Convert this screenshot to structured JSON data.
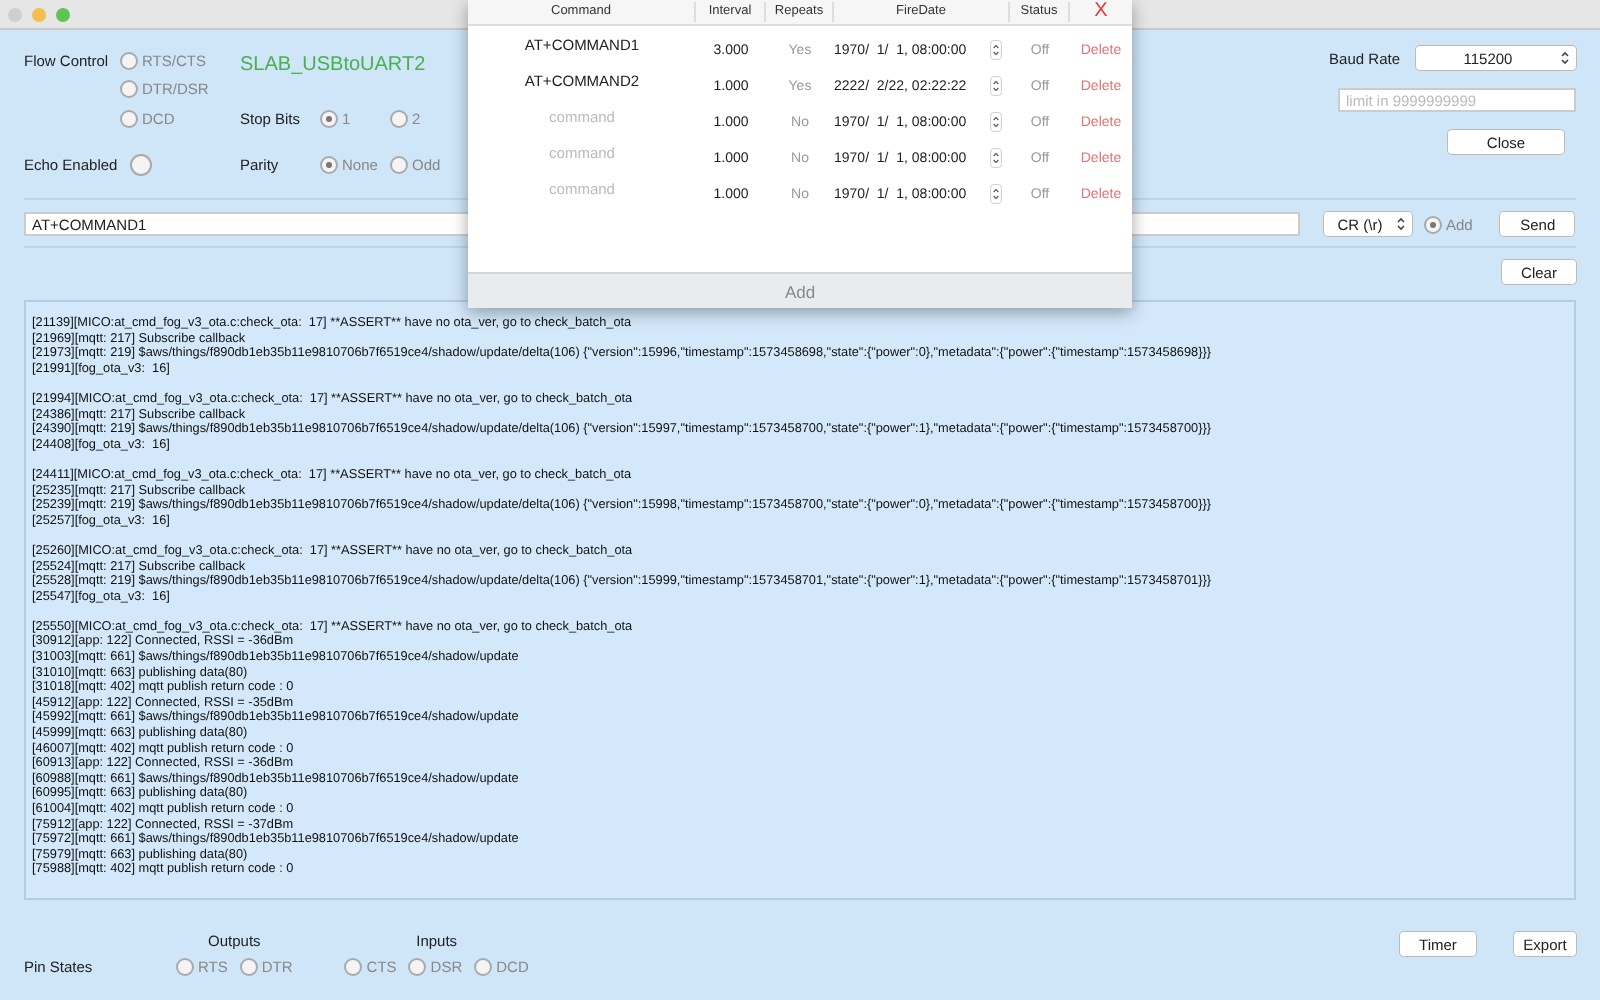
{
  "flow_control": {
    "label": "Flow Control",
    "options": [
      {
        "label": "RTS/CTS",
        "selected": false
      },
      {
        "label": "DTR/DSR",
        "selected": false
      },
      {
        "label": "DCD",
        "selected": false
      }
    ]
  },
  "device": "SLAB_USBtoUART2",
  "stop_bits": {
    "label": "Stop Bits",
    "options": [
      {
        "label": "1",
        "selected": true
      },
      {
        "label": "2",
        "selected": false
      }
    ]
  },
  "echo": {
    "label": "Echo Enabled",
    "checked": false
  },
  "parity": {
    "label": "Parity",
    "options": [
      {
        "label": "None",
        "selected": true
      },
      {
        "label": "Odd",
        "selected": false
      }
    ]
  },
  "baud_rate": {
    "label": "Baud Rate",
    "value": "115200"
  },
  "limit_field": {
    "placeholder": "limit in 9999999999"
  },
  "close_button": "Close",
  "command_field": {
    "value": "AT+COMMAND1"
  },
  "line_ending": {
    "value": "CR (\\r)"
  },
  "add_option": {
    "label": "Add",
    "selected": true
  },
  "send_button": "Send",
  "clear_button": "Clear",
  "log": [
    [
      "[21139][MICO:at_cmd_fog_v3_ota.c:check_ota:  17] **ASSERT** have no ota_ver, go to check_batch_ota",
      "[21969][mqtt: 217] Subscribe callback",
      "[21973][mqtt: 219] $aws/things/f890db1eb35b11e9810706b7f6519ce4/shadow/update/delta(106) {\"version\":15996,\"timestamp\":1573458698,\"state\":{\"power\":0},\"metadata\":{\"power\":{\"timestamp\":1573458698}}}",
      "[21991][fog_ota_v3:  16]"
    ],
    [
      "[21994][MICO:at_cmd_fog_v3_ota.c:check_ota:  17] **ASSERT** have no ota_ver, go to check_batch_ota",
      "[24386][mqtt: 217] Subscribe callback",
      "[24390][mqtt: 219] $aws/things/f890db1eb35b11e9810706b7f6519ce4/shadow/update/delta(106) {\"version\":15997,\"timestamp\":1573458700,\"state\":{\"power\":1},\"metadata\":{\"power\":{\"timestamp\":1573458700}}}",
      "[24408][fog_ota_v3:  16]"
    ],
    [
      "[24411][MICO:at_cmd_fog_v3_ota.c:check_ota:  17] **ASSERT** have no ota_ver, go to check_batch_ota",
      "[25235][mqtt: 217] Subscribe callback",
      "[25239][mqtt: 219] $aws/things/f890db1eb35b11e9810706b7f6519ce4/shadow/update/delta(106) {\"version\":15998,\"timestamp\":1573458700,\"state\":{\"power\":0},\"metadata\":{\"power\":{\"timestamp\":1573458700}}}",
      "[25257][fog_ota_v3:  16]"
    ],
    [
      "[25260][MICO:at_cmd_fog_v3_ota.c:check_ota:  17] **ASSERT** have no ota_ver, go to check_batch_ota",
      "[25524][mqtt: 217] Subscribe callback",
      "[25528][mqtt: 219] $aws/things/f890db1eb35b11e9810706b7f6519ce4/shadow/update/delta(106) {\"version\":15999,\"timestamp\":1573458701,\"state\":{\"power\":1},\"metadata\":{\"power\":{\"timestamp\":1573458701}}}",
      "[25547][fog_ota_v3:  16]"
    ],
    [
      "[25550][MICO:at_cmd_fog_v3_ota.c:check_ota:  17] **ASSERT** have no ota_ver, go to check_batch_ota",
      "[30912][app: 122] Connected, RSSI = -36dBm",
      "[31003][mqtt: 661] $aws/things/f890db1eb35b11e9810706b7f6519ce4/shadow/update",
      "[31010][mqtt: 663] publishing data(80)",
      "[31018][mqtt: 402] mqtt publish return code : 0",
      "[45912][app: 122] Connected, RSSI = -35dBm",
      "[45992][mqtt: 661] $aws/things/f890db1eb35b11e9810706b7f6519ce4/shadow/update",
      "[45999][mqtt: 663] publishing data(80)",
      "[46007][mqtt: 402] mqtt publish return code : 0",
      "[60913][app: 122] Connected, RSSI = -36dBm",
      "[60988][mqtt: 661] $aws/things/f890db1eb35b11e9810706b7f6519ce4/shadow/update",
      "[60995][mqtt: 663] publishing data(80)",
      "[61004][mqtt: 402] mqtt publish return code : 0",
      "[75912][app: 122] Connected, RSSI = -37dBm",
      "[75972][mqtt: 661] $aws/things/f890db1eb35b11e9810706b7f6519ce4/shadow/update",
      "[75979][mqtt: 663] publishing data(80)",
      "[75988][mqtt: 402] mqtt publish return code : 0"
    ]
  ],
  "pin_states": {
    "label": "Pin States",
    "groups": [
      {
        "title": "Outputs",
        "pins": [
          {
            "label": "RTS",
            "selected": false
          },
          {
            "label": "DTR",
            "selected": false
          }
        ]
      },
      {
        "title": "Inputs",
        "pins": [
          {
            "label": "CTS",
            "selected": false
          },
          {
            "label": "DSR",
            "selected": false
          },
          {
            "label": "DCD",
            "selected": false
          }
        ]
      }
    ]
  },
  "timer_button": "Timer",
  "export_button": "Export",
  "timer_popup": {
    "columns": [
      "Command",
      "Interval",
      "Repeats",
      "FireDate",
      "Status"
    ],
    "close": "X",
    "rows": [
      {
        "command": "AT+COMMAND1",
        "interval": "3.000",
        "repeats": "Yes",
        "fire_date": "1970/  1/  1, 08:00:00",
        "status": "Off",
        "action": "Delete"
      },
      {
        "command": "AT+COMMAND2",
        "interval": "1.000",
        "repeats": "Yes",
        "fire_date": "2222/  2/22, 02:22:22",
        "status": "Off",
        "action": "Delete"
      },
      {
        "placeholder": "command",
        "interval": "1.000",
        "repeats": "No",
        "fire_date": "1970/  1/  1, 08:00:00",
        "status": "Off",
        "action": "Delete"
      },
      {
        "placeholder": "command",
        "interval": "1.000",
        "repeats": "No",
        "fire_date": "1970/  1/  1, 08:00:00",
        "status": "Off",
        "action": "Delete"
      },
      {
        "placeholder": "command",
        "interval": "1.000",
        "repeats": "No",
        "fire_date": "1970/  1/  1, 08:00:00",
        "status": "Off",
        "action": "Delete"
      }
    ],
    "add_button": "Add"
  }
}
